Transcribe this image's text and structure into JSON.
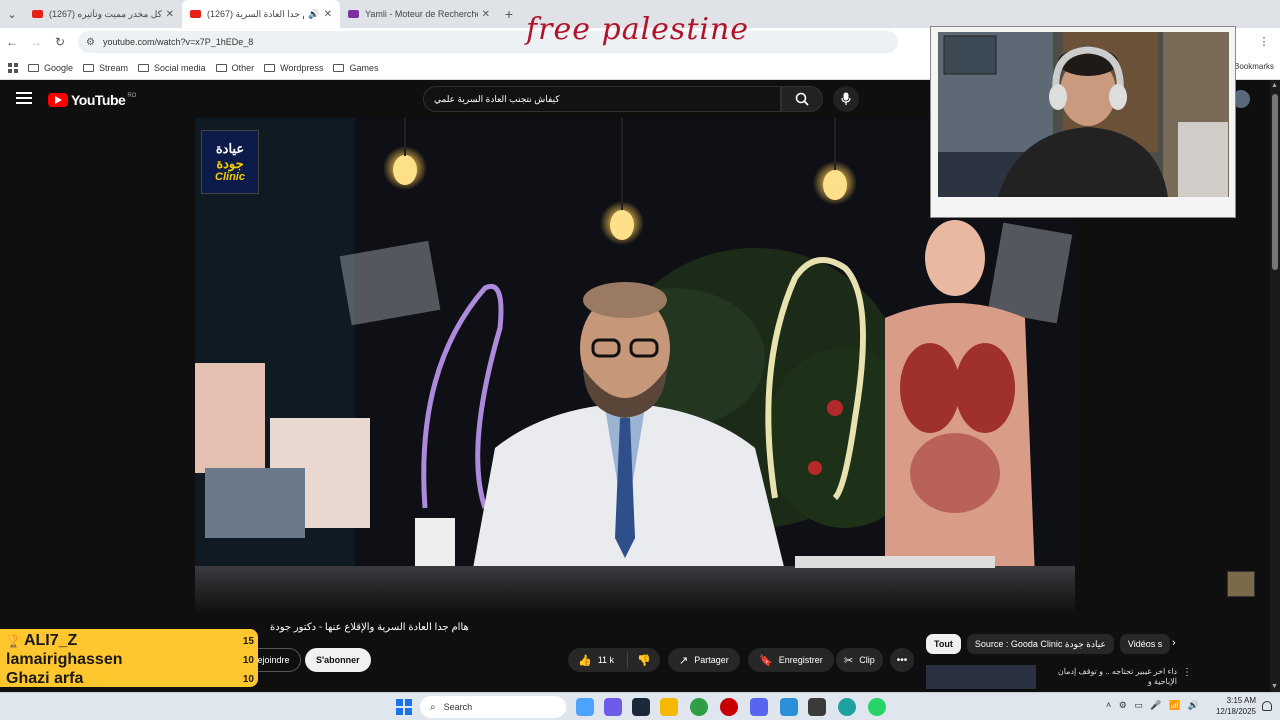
{
  "browser": {
    "tabs": [
      {
        "title": "(1267) شرح كل مخدر مميت وتأثيره",
        "color": "#e62117",
        "active": false
      },
      {
        "title": "(1267) هاام جدا العادة السرية",
        "color": "#e62117",
        "active": true
      },
      {
        "title": "Yamli - Moteur de Recherche A",
        "color": "#7b2fa0",
        "active": false
      }
    ],
    "url": "youtube.com/watch?v=x7P_1hEDe_8",
    "bookmarks": [
      "Google",
      "Stream",
      "Social media",
      "Other",
      "Wordpress",
      "Games"
    ],
    "bookmarks_right": "Bookmarks"
  },
  "overlay": {
    "title": "free palestine"
  },
  "youtube": {
    "logo_text": "YouTube",
    "region": "RO",
    "search_value": "كيفاش نتجنب العادة السرية علمي",
    "channel_logo": {
      "line1": "عيادة",
      "line2": "جودة",
      "line3": "Clinic"
    },
    "video_title": "هاام جدا العادة السرية والإقلاع عنها - دكتور جودة",
    "join_label": "Rejoindre",
    "subscribe_label": "S'abonner",
    "likes": "11 k",
    "share_label": "Partager",
    "save_label": "Enregistrer",
    "clip_label": "Clip",
    "chips": [
      "Tout",
      "Source : Gooda Clinic عيادة جودة",
      "Vidéos s"
    ],
    "recommended_title": "داء اخر غيبير تحتاجه .. و توقف إدمان الإباحية و"
  },
  "leaderboard": [
    {
      "name": "ALI7_Z",
      "score": "15",
      "trophy": true
    },
    {
      "name": "lamairighassen",
      "score": "10",
      "trophy": false
    },
    {
      "name": "Ghazi arfa",
      "score": "10",
      "trophy": false
    }
  ],
  "taskbar": {
    "search_placeholder": "Search",
    "time": "3:15 AM",
    "date": "12/18/2025"
  },
  "colors": {
    "yt_red": "#ff0000",
    "overlay_red": "#b1132b",
    "leaderboard_yellow": "#ffc62e",
    "yt_bg": "#0f0f0f"
  }
}
